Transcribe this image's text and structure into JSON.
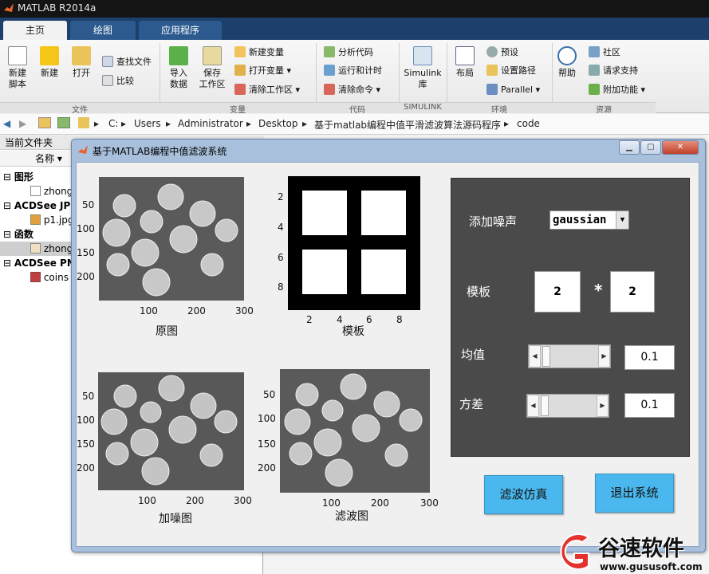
{
  "app": {
    "title": "MATLAB R2014a"
  },
  "tabs": [
    "主页",
    "绘图",
    "应用程序"
  ],
  "ribbon": {
    "file": {
      "new_script": "新建\n脚本",
      "new": "新建",
      "open": "打开",
      "find_files": "查找文件",
      "compare": "比较",
      "section": "文件"
    },
    "variable": {
      "import": "导入\n数据",
      "save_ws": "保存\n工作区",
      "new_var": "新建变量",
      "open_var": "打开变量",
      "clear_ws": "清除工作区",
      "section": "变量"
    },
    "code": {
      "analyze": "分析代码",
      "run_time": "运行和计时",
      "clear_cmd": "清除命令",
      "section": "代码"
    },
    "simulink": {
      "lib": "Simulink\n库",
      "section": "SIMULINK"
    },
    "env": {
      "layout": "布局",
      "prefs": "预设",
      "set_path": "设置路径",
      "parallel": "Parallel",
      "section": "环境"
    },
    "resources": {
      "help": "帮助",
      "community": "社区",
      "request_support": "请求支持",
      "addons": "附加功能",
      "section": "资源"
    }
  },
  "path": [
    "C:",
    "Users",
    "Administrator",
    "Desktop",
    "基于matlab编程中值平滑滤波算法源码程序",
    "code"
  ],
  "left_pane": {
    "title": "当前文件夹",
    "col_name": "名称",
    "groups": [
      {
        "label": "图形",
        "file": "zhong"
      },
      {
        "label": "ACDSee JPI",
        "file": "p1.jpg"
      },
      {
        "label": "函数",
        "file": "zhong"
      },
      {
        "label": "ACDSee PN",
        "file": "coins"
      }
    ]
  },
  "figure": {
    "title": "基于MATLAB编程中值滤波系统",
    "axes": {
      "orig": {
        "caption": "原图",
        "yticks": [
          "50",
          "100",
          "150",
          "200"
        ],
        "xticks": [
          "100",
          "200",
          "300"
        ]
      },
      "template": {
        "caption": "模板",
        "yticks": [
          "2",
          "4",
          "6",
          "8"
        ],
        "xticks": [
          "2",
          "4",
          "6",
          "8"
        ]
      },
      "noisy": {
        "caption": "加噪图",
        "yticks": [
          "50",
          "100",
          "150",
          "200"
        ],
        "xticks": [
          "100",
          "200",
          "300"
        ]
      },
      "filtered": {
        "caption": "滤波图",
        "yticks": [
          "50",
          "100",
          "150",
          "200"
        ],
        "xticks": [
          "100",
          "200",
          "300"
        ]
      }
    },
    "panel": {
      "add_noise_label": "添加噪声",
      "noise_type": "gaussian",
      "template_label": "模板",
      "template_rows": "2",
      "times": "*",
      "template_cols": "2",
      "mean_label": "均值",
      "mean_value": "0.1",
      "variance_label": "方差",
      "variance_value": "0.1"
    },
    "buttons": {
      "filter_sim": "滤波仿真",
      "exit": "退出系统"
    }
  },
  "watermark": {
    "brand": "谷速软件",
    "url": "www.gususoft.com"
  },
  "colors": {
    "button_blue": "#4ab8ee",
    "panel_gray": "#4a4a4a",
    "watermark_red": "#e5322d"
  }
}
